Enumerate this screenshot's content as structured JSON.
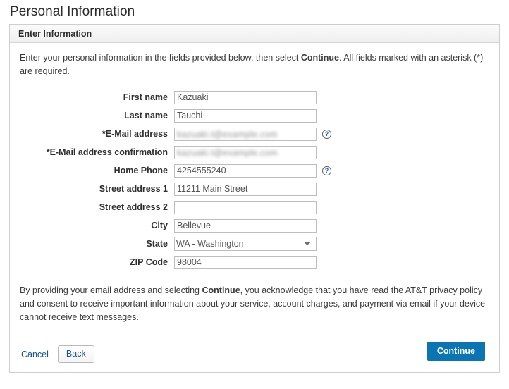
{
  "page_title": "Personal Information",
  "panel": {
    "header_title": "Enter Information",
    "intro_prefix": "Enter your personal information in the fields provided below, then select ",
    "intro_bold": "Continue",
    "intro_suffix": ". All fields marked with an asterisk (*) are required."
  },
  "form": {
    "fields": [
      {
        "label": "First name",
        "value": "Kazuaki",
        "placeholder": "",
        "type": "text",
        "name": "first-name",
        "required": false,
        "help": false,
        "redacted": false
      },
      {
        "label": "Last name",
        "value": "Tauchi",
        "placeholder": "",
        "type": "text",
        "name": "last-name",
        "required": false,
        "help": false,
        "redacted": false
      },
      {
        "label": "*E-Mail address",
        "value": "",
        "redacted_value": "kazuaki.t@example.com",
        "placeholder": "",
        "type": "text",
        "name": "email-address",
        "required": true,
        "help": true,
        "redacted": true
      },
      {
        "label": "*E-Mail address confirmation",
        "value": "",
        "redacted_value": "kazuaki.t@example.com",
        "placeholder": "",
        "type": "text",
        "name": "email-address-confirmation",
        "required": true,
        "help": false,
        "redacted": true
      },
      {
        "label": "Home Phone",
        "value": "4254555240",
        "placeholder": "",
        "type": "text",
        "name": "home-phone",
        "required": false,
        "help": true,
        "redacted": false
      },
      {
        "label": "Street address 1",
        "value": "11211 Main Street",
        "placeholder": "",
        "type": "text",
        "name": "street-address-1",
        "required": false,
        "help": false,
        "redacted": false
      },
      {
        "label": "Street address 2",
        "value": "",
        "placeholder": "",
        "type": "text",
        "name": "street-address-2",
        "required": false,
        "help": false,
        "redacted": false
      },
      {
        "label": "City",
        "value": "Bellevue",
        "placeholder": "",
        "type": "text",
        "name": "city",
        "required": false,
        "help": false,
        "redacted": false
      },
      {
        "label": "State",
        "value": "WA - Washington",
        "placeholder": "",
        "type": "select",
        "name": "state",
        "required": false,
        "help": false,
        "redacted": false
      },
      {
        "label": "ZIP Code",
        "value": "98004",
        "placeholder": "",
        "type": "text",
        "name": "zip-code",
        "required": false,
        "help": false,
        "redacted": false
      }
    ],
    "help_icon_glyph": "?"
  },
  "disclaimer": {
    "prefix": "By providing your email address and selecting ",
    "bold": "Continue",
    "suffix": ", you acknowledge that you have read the AT&T privacy policy and consent to receive important information about your service, account charges, and payment via email if your device cannot receive text messages."
  },
  "footer": {
    "cancel_label": "Cancel",
    "back_label": "Back",
    "continue_label": "Continue"
  },
  "colors": {
    "accent_blue": "#0a74b5",
    "link_blue": "#17558d",
    "panel_border": "#cfcfcf",
    "input_border": "#bdbdbd"
  }
}
